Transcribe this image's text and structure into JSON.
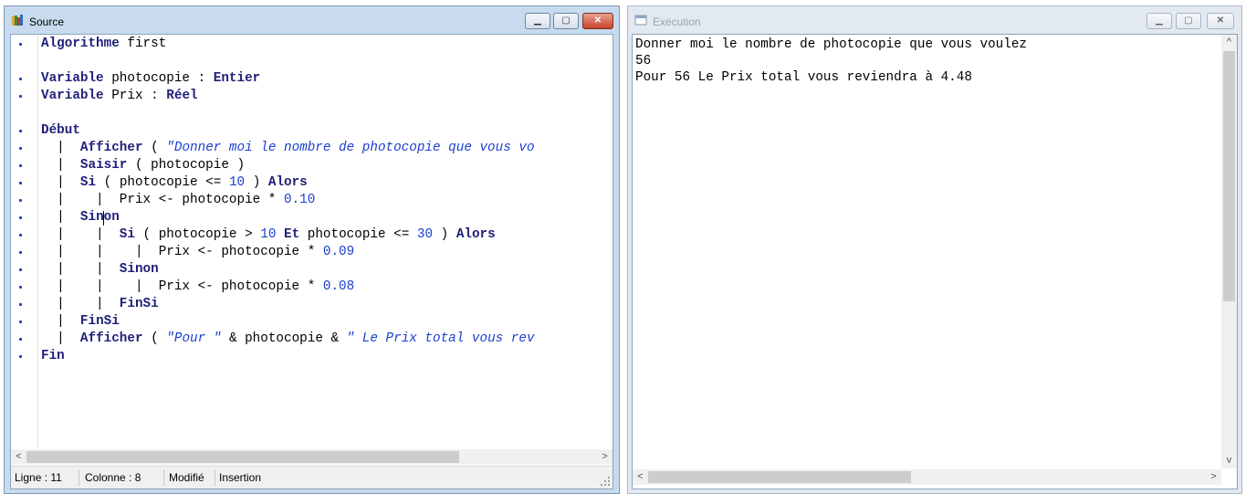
{
  "source_window": {
    "title": "Source",
    "buttons": {
      "minimize": "▁",
      "maximize": "▢",
      "close": "✕"
    },
    "code_lines": [
      [
        {
          "t": "kw",
          "v": "Algorithme"
        },
        {
          "t": "plain",
          "v": " first"
        }
      ],
      [],
      [
        {
          "t": "kw",
          "v": "Variable"
        },
        {
          "t": "plain",
          "v": " photocopie : "
        },
        {
          "t": "kw",
          "v": "Entier"
        }
      ],
      [
        {
          "t": "kw",
          "v": "Variable"
        },
        {
          "t": "plain",
          "v": " Prix : "
        },
        {
          "t": "kw",
          "v": "Réel"
        }
      ],
      [],
      [
        {
          "t": "kw",
          "v": "Début"
        }
      ],
      [
        {
          "t": "plain",
          "v": "  |  "
        },
        {
          "t": "kw",
          "v": "Afficher"
        },
        {
          "t": "plain",
          "v": " ( "
        },
        {
          "t": "str",
          "v": "\"Donner moi le nombre de photocopie que vous vo"
        }
      ],
      [
        {
          "t": "plain",
          "v": "  |  "
        },
        {
          "t": "kw",
          "v": "Saisir"
        },
        {
          "t": "plain",
          "v": " ( photocopie )"
        }
      ],
      [
        {
          "t": "plain",
          "v": "  |  "
        },
        {
          "t": "kw",
          "v": "Si"
        },
        {
          "t": "plain",
          "v": " ( photocopie <= "
        },
        {
          "t": "num",
          "v": "10"
        },
        {
          "t": "plain",
          "v": " ) "
        },
        {
          "t": "kw",
          "v": "Alors"
        }
      ],
      [
        {
          "t": "plain",
          "v": "  |    |  Prix <- photocopie * "
        },
        {
          "t": "num",
          "v": "0.10"
        }
      ],
      [
        {
          "t": "plain",
          "v": "  |  "
        },
        {
          "t": "kw",
          "v": "Sinon"
        }
      ],
      [
        {
          "t": "plain",
          "v": "  |    |  "
        },
        {
          "t": "kw",
          "v": "Si"
        },
        {
          "t": "plain",
          "v": " ( photocopie > "
        },
        {
          "t": "num",
          "v": "10"
        },
        {
          "t": "plain",
          "v": " "
        },
        {
          "t": "kw",
          "v": "Et"
        },
        {
          "t": "plain",
          "v": " photocopie <= "
        },
        {
          "t": "num",
          "v": "30"
        },
        {
          "t": "plain",
          "v": " ) "
        },
        {
          "t": "kw",
          "v": "Alors"
        }
      ],
      [
        {
          "t": "plain",
          "v": "  |    |    |  Prix <- photocopie * "
        },
        {
          "t": "num",
          "v": "0.09"
        }
      ],
      [
        {
          "t": "plain",
          "v": "  |    |  "
        },
        {
          "t": "kw",
          "v": "Sinon"
        }
      ],
      [
        {
          "t": "plain",
          "v": "  |    |    |  Prix <- photocopie * "
        },
        {
          "t": "num",
          "v": "0.08"
        }
      ],
      [
        {
          "t": "plain",
          "v": "  |    |  "
        },
        {
          "t": "kw",
          "v": "FinSi"
        }
      ],
      [
        {
          "t": "plain",
          "v": "  |  "
        },
        {
          "t": "kw",
          "v": "FinSi"
        }
      ],
      [
        {
          "t": "plain",
          "v": "  |  "
        },
        {
          "t": "kw",
          "v": "Afficher"
        },
        {
          "t": "plain",
          "v": " ( "
        },
        {
          "t": "str",
          "v": "\"Pour \""
        },
        {
          "t": "plain",
          "v": " & photocopie & "
        },
        {
          "t": "str",
          "v": "\" Le Prix total vous rev"
        }
      ],
      [
        {
          "t": "kw",
          "v": "Fin"
        }
      ]
    ],
    "status": {
      "line": "Ligne : 11",
      "column": "Colonne : 8",
      "modified": "Modifié",
      "mode": "Insertion"
    },
    "scroll_arrows": {
      "left": "<",
      "right": ">"
    }
  },
  "exec_window": {
    "title": "Exécution",
    "buttons": {
      "minimize": "▁",
      "maximize": "▢",
      "close": "✕"
    },
    "output_lines": [
      "Donner moi le nombre de photocopie que vous voulez",
      "56",
      "Pour 56 Le Prix total vous reviendra à 4.48"
    ],
    "scroll_arrows": {
      "left": "<",
      "right": ">",
      "up": "^",
      "down": "v"
    }
  },
  "colors": {
    "keyword": "#1f1f7a",
    "string": "#1a3fd0",
    "number": "#1a3fd0",
    "bullet": "#1b3fbf",
    "close_button": "#c7442d"
  }
}
